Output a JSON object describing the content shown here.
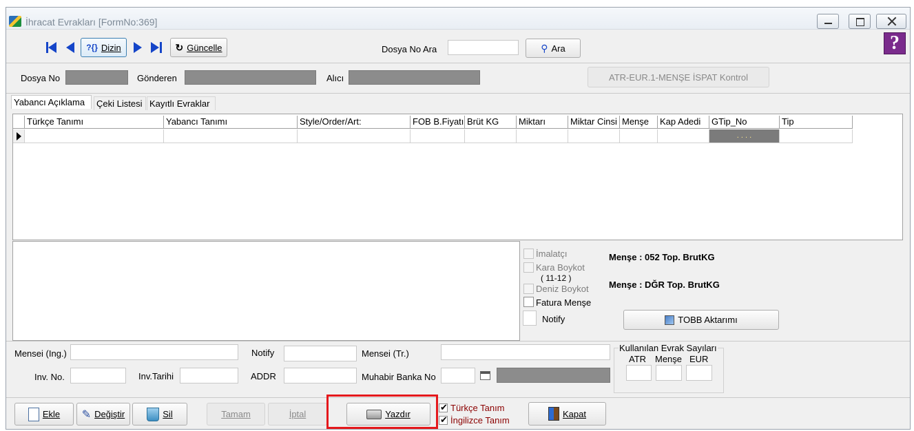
{
  "window": {
    "title": "İhracat Evrakları [FormNo:369]",
    "help_glyph": "?"
  },
  "toolbar": {
    "dizin_label": "Dizin",
    "guncelle_label": "Güncelle",
    "search_label": "Dosya No Ara",
    "search_value": "",
    "ara_label": "Ara"
  },
  "info": {
    "dosya_no_label": "Dosya No",
    "gonderen_label": "Gönderen",
    "alici_label": "Alıcı",
    "kontrol_button": "ATR-EUR.1-MENŞE İSPAT Kontrol"
  },
  "tabs": [
    "Yabancı Açıklama",
    "Çeki Listesi",
    "Kayıtlı Evraklar"
  ],
  "grid": {
    "columns": [
      "Türkçe Tanımı",
      "Yabancı Tanımı",
      "Style/Order/Art:",
      "FOB B.Fiyatı",
      "Brüt KG",
      "Miktarı",
      "Miktar Cinsi",
      "Menşe",
      "Kap Adedi",
      "GTip_No",
      "Tip"
    ],
    "gtip_value": ". . . ."
  },
  "options": {
    "imalatci": "İmalatçı",
    "kara_boykot": "Kara Boykot",
    "kara_boykot_sub": "( 11-12 )",
    "deniz_boykot": "Deniz Boykot",
    "fatura_mense": "Fatura Menşe",
    "notify": "Notify",
    "mense1": "Menşe : 052  Top. BrutKG",
    "mense2": "Menşe : DĞR  Top. BrutKG",
    "tobb_button": "TOBB Aktarımı"
  },
  "fields": {
    "mensei_ing": "Mensei (Ing.)",
    "notify": "Notify",
    "mensei_tr": "Mensei (Tr.)",
    "inv_no": "Inv. No.",
    "inv_tarihi": "Inv.Tarihi",
    "addr": "ADDR",
    "muhabir": "Muhabir Banka No"
  },
  "evrak": {
    "title": "Kullanılan Evrak Sayıları",
    "atr": "ATR",
    "mense": "Menşe",
    "eur": "EUR"
  },
  "bottom": {
    "ekle": "Ekle",
    "degistir": "Değiştir",
    "sil": "Sil",
    "tamam": "Tamam",
    "iptal": "İptal",
    "yazdir": "Yazdır",
    "turkce_tanim": "Türkçe Tanım",
    "ingilizce_tanim": "İngilizce Tanım",
    "kapat": "Kapat"
  },
  "colors": {
    "accent_blue": "#1545c8",
    "highlight_red": "#e5181c",
    "dark_red_text": "#8b0000"
  }
}
